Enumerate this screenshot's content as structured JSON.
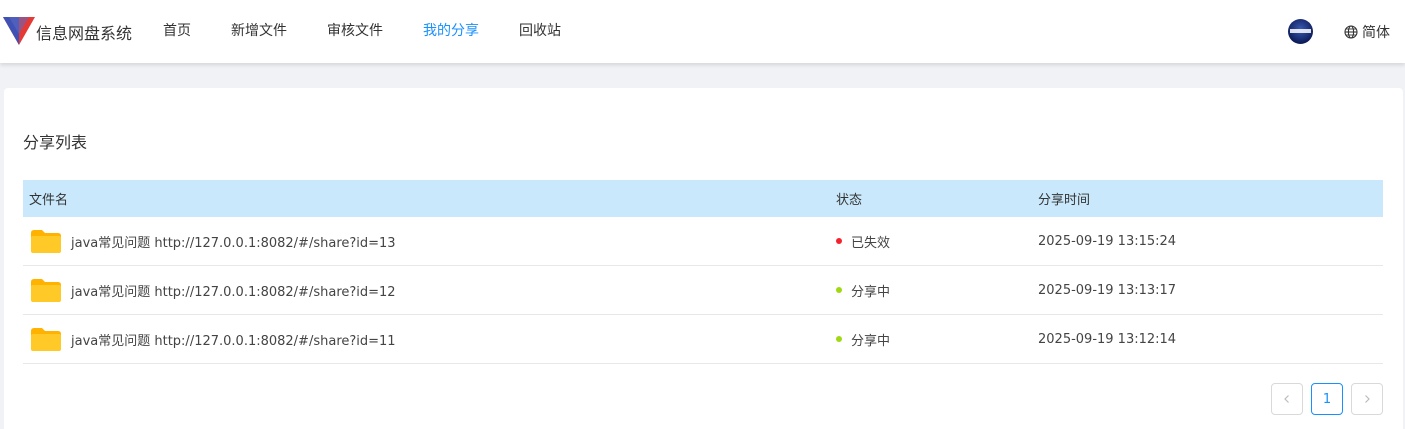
{
  "app": {
    "name": "信息网盘系统"
  },
  "nav": {
    "items": [
      {
        "label": "首页"
      },
      {
        "label": "新增文件"
      },
      {
        "label": "审核文件"
      },
      {
        "label": "我的分享"
      },
      {
        "label": "回收站"
      }
    ],
    "active_label": "我的分享"
  },
  "header": {
    "language_label": "简体",
    "language_icon": "globe-icon",
    "avatar_icon": "user-avatar"
  },
  "page": {
    "title": "分享列表"
  },
  "table": {
    "columns": [
      "文件名",
      "状态",
      "分享时间"
    ],
    "rows": [
      {
        "name": "java常见问题 http://127.0.0.1:8082/#/share?id=13",
        "status": "已失效",
        "status_color": "#f5222d",
        "time": "2025-09-19 13:15:24"
      },
      {
        "name": "java常见问题 http://127.0.0.1:8082/#/share?id=12",
        "status": "分享中",
        "status_color": "#a0d911",
        "time": "2025-09-19 13:13:17"
      },
      {
        "name": "java常见问题 http://127.0.0.1:8082/#/share?id=11",
        "status": "分享中",
        "status_color": "#a0d911",
        "time": "2025-09-19 13:12:14"
      }
    ]
  },
  "pagination": {
    "prev_icon": "chevron-left-icon",
    "current_page": "1",
    "next_icon": "chevron-right-icon"
  },
  "colors": {
    "accent": "#1890ff",
    "header_row_bg": "#c9e8fb",
    "folder": "#ffca28"
  }
}
